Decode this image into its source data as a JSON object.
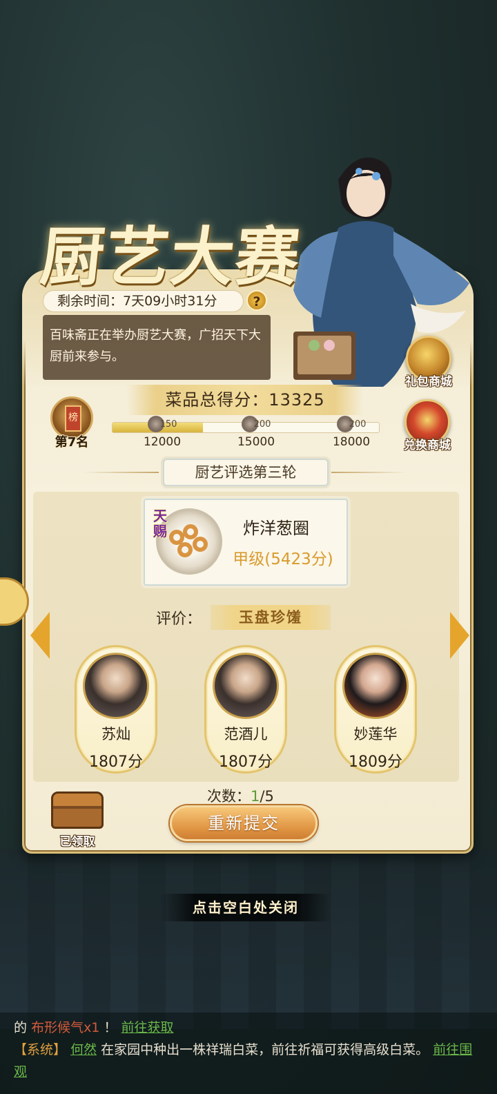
{
  "title": "厨艺大赛",
  "timer": {
    "label": "剩余时间：7天09小时31分",
    "help": "?"
  },
  "description": "百味斋正在举办厨艺大赛，广招天下大厨前来参与。",
  "side_buttons": {
    "gift_shop": "礼包商城",
    "exchange_shop": "兑换商城"
  },
  "total_score": "菜品总得分：13325",
  "rank": {
    "icon_text": "榜",
    "label": "第7名"
  },
  "progress": {
    "fill_fraction": 0.34,
    "milestones": [
      {
        "amount": "150",
        "threshold": "12000"
      },
      {
        "amount": "200",
        "threshold": "15000"
      },
      {
        "amount": "200",
        "threshold": "18000"
      }
    ]
  },
  "round_title": "厨艺评选第三轮",
  "dish": {
    "tag": "天赐",
    "name": "炸洋葱圈",
    "grade": "甲级(5423分)"
  },
  "evaluation": {
    "label": "评价：",
    "value": "玉盘珍馐"
  },
  "judges": [
    {
      "name": "苏灿",
      "score": "1807分"
    },
    {
      "name": "范酒儿",
      "score": "1807分"
    },
    {
      "name": "妙莲华",
      "score": "1809分"
    }
  ],
  "attempts": {
    "label": "次数：",
    "current": "1",
    "total": "/5"
  },
  "chest": {
    "label": "已领取"
  },
  "resubmit_label": "重新提交",
  "close_hint": "点击空白处关闭",
  "chat": {
    "line1_prefix": "的",
    "line1_item": "布形候气x1",
    "line1_mid": "！",
    "line1_link": "前往获取",
    "line2_sys": "【系统】",
    "line2_user": "何然",
    "line2_text": "在家园中种出一株祥瑞白菜，前往祈福可获得高级白菜。",
    "line2_link": "前往围观"
  },
  "colors": {
    "accent": "#e5a52c",
    "gold": "#d9bd78",
    "grade": "#d99b2e",
    "resubmit": "#e29a48"
  }
}
